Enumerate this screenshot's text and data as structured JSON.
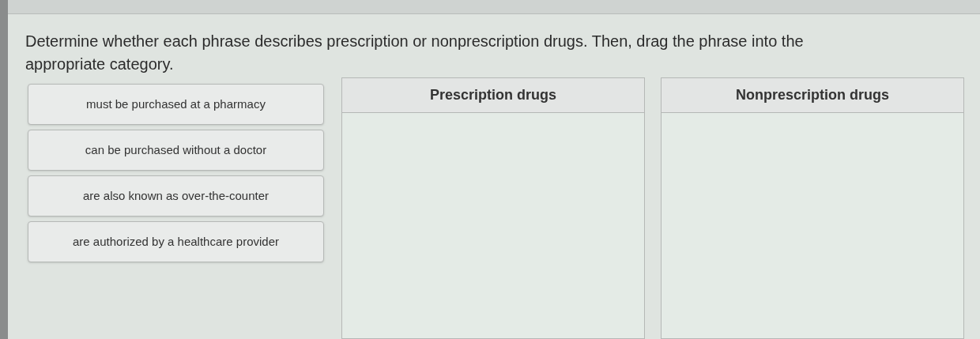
{
  "instructions": "Determine whether each phrase describes prescription or nonprescription drugs. Then, drag the phrase into the appropriate category.",
  "phrases": [
    {
      "text": "must be purchased at a pharmacy"
    },
    {
      "text": "can be purchased without a doctor"
    },
    {
      "text": "are also known as over-the-counter"
    },
    {
      "text": "are authorized by a healthcare provider"
    }
  ],
  "categories": [
    {
      "title": "Prescription drugs"
    },
    {
      "title": "Nonprescription drugs"
    }
  ]
}
